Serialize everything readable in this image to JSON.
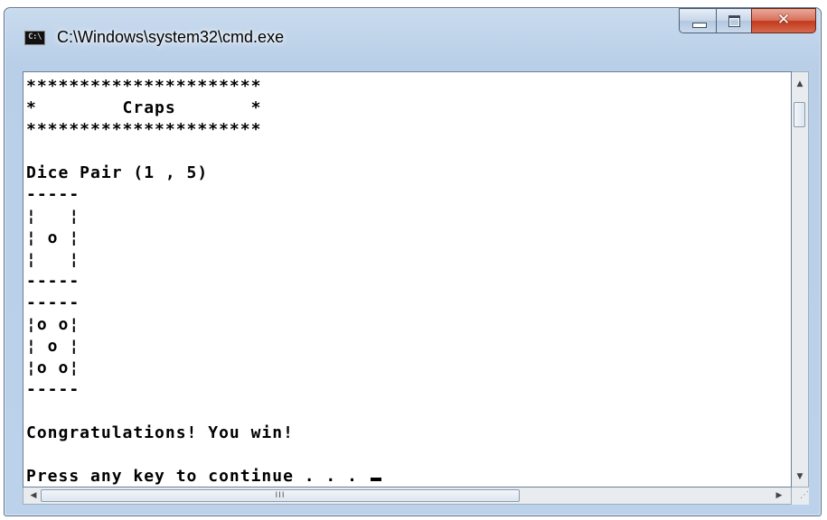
{
  "window": {
    "title": "C:\\Windows\\system32\\cmd.exe",
    "app_icon_text": "C:\\"
  },
  "console": {
    "lines": [
      "**********************",
      "*        Craps       *",
      "**********************",
      "",
      "Dice Pair (1 , 5)",
      "-----",
      "¦   ¦",
      "¦ o ¦",
      "¦   ¦",
      "-----",
      "-----",
      "¦o o¦",
      "¦ o ¦",
      "¦o o¦",
      "-----",
      "",
      "Congratulations! You win!",
      "",
      "Press any key to continue . . . "
    ]
  },
  "scrollbar": {
    "horizontal_thumb_grip": "III"
  },
  "colors": {
    "console_bg": "#ffffff",
    "console_text": "#000000",
    "close_button": "#c7402a",
    "frame": "#bcd2ea"
  },
  "icons": {
    "minimize": "minimize-icon",
    "maximize": "maximize-icon",
    "close": "close-icon",
    "scroll_up": "arrow-up-icon",
    "scroll_down": "arrow-down-icon",
    "scroll_left": "arrow-left-icon",
    "scroll_right": "arrow-right-icon"
  }
}
